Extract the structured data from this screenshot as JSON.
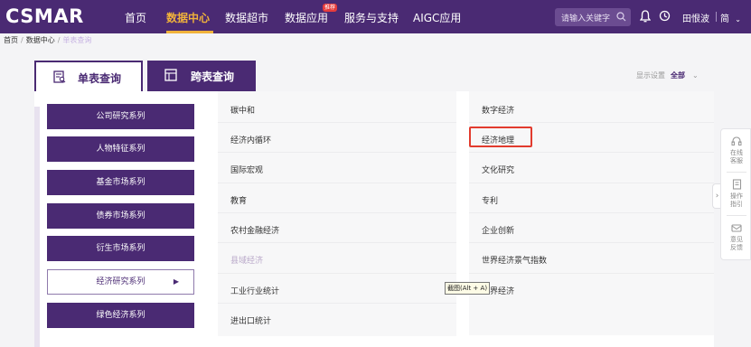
{
  "brand": "CSMAR",
  "nav": {
    "items": [
      {
        "label": "首页"
      },
      {
        "label": "数据中心",
        "active": true
      },
      {
        "label": "数据超市"
      },
      {
        "label": "数据应用",
        "badge": "推荐"
      },
      {
        "label": "服务与支持"
      },
      {
        "label": "AIGC应用"
      }
    ],
    "search_placeholder": "请输入关键字",
    "user": "田恨波",
    "lang": "简",
    "icons": [
      "search-icon",
      "bell-icon",
      "history-icon",
      "chevron-down-icon"
    ]
  },
  "breadcrumb": [
    "首页",
    "数据中心",
    "单表查询"
  ],
  "tabs": [
    {
      "label": "单表查询",
      "active": true,
      "icon": "single-table-icon"
    },
    {
      "label": "跨表查询",
      "active": false,
      "icon": "cross-table-icon"
    }
  ],
  "display_settings": {
    "label": "显示设置",
    "value": "全部"
  },
  "series": [
    {
      "label": "公司研究系列"
    },
    {
      "label": "人物特征系列"
    },
    {
      "label": "基金市场系列"
    },
    {
      "label": "债券市场系列"
    },
    {
      "label": "衍生市场系列"
    },
    {
      "label": "经济研究系列",
      "active": true
    },
    {
      "label": "绿色经济系列"
    }
  ],
  "categories_mid": [
    {
      "label": "碳中和"
    },
    {
      "label": "经济内循环"
    },
    {
      "label": "国际宏观"
    },
    {
      "label": "教育"
    },
    {
      "label": "农村金融经济"
    },
    {
      "label": "县域经济",
      "dim": true
    },
    {
      "label": "工业行业统计"
    },
    {
      "label": "进出口统计"
    }
  ],
  "categories_right": [
    {
      "label": "数字经济"
    },
    {
      "label": "经济地理",
      "highlighted": true
    },
    {
      "label": "文化研究"
    },
    {
      "label": "专利"
    },
    {
      "label": "企业创新"
    },
    {
      "label": "世界经济景气指数"
    },
    {
      "label": "世界经济"
    }
  ],
  "tooltip": "截图(Alt + A)",
  "float_bar": [
    {
      "label1": "在线",
      "label2": "客服",
      "icon": "headset-icon"
    },
    {
      "label1": "操作",
      "label2": "指引",
      "icon": "guide-icon"
    },
    {
      "label1": "意见",
      "label2": "反馈",
      "icon": "feedback-icon"
    }
  ],
  "colors": {
    "brand": "#4a2a73",
    "accent": "#f0b23b",
    "highlight": "#e23b2e"
  }
}
